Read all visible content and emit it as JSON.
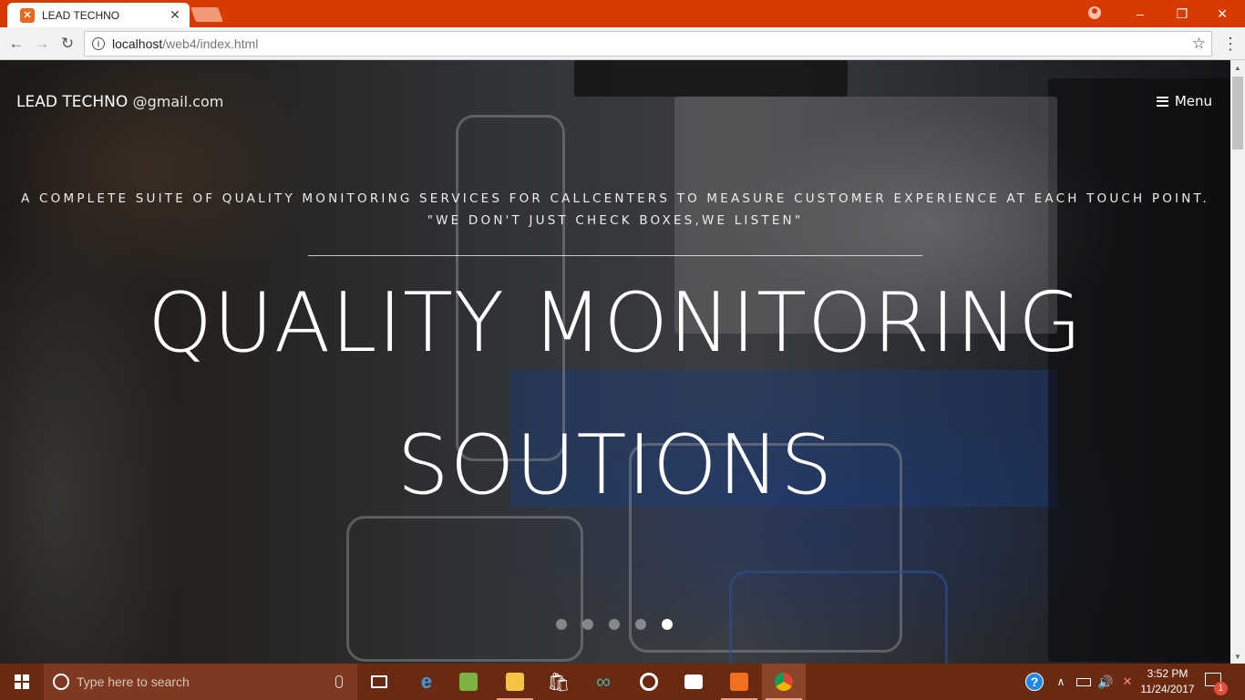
{
  "browser": {
    "tab_title": "LEAD TECHNO",
    "tab_favicon": "xampp-icon",
    "url_host": "localhost",
    "url_path": "/web4/index.html"
  },
  "site": {
    "brand_main": "LEAD TECHNO",
    "brand_sub": "@gmail.com",
    "menu_label": "Menu",
    "tagline_line1": "A COMPLETE SUITE OF QUALITY MONITORING SERVICES FOR CALLCENTERS TO MEASURE CUSTOMER EXPERIENCE AT EACH TOUCH POINT.",
    "tagline_line2": "\"WE DON'T JUST CHECK BOXES,WE LISTEN\"",
    "headline_line1": "QUALITY MONITORING",
    "headline_line2": "SOUTIONS",
    "carousel": {
      "slide_count": 5,
      "active_index": 4
    }
  },
  "taskbar": {
    "search_placeholder": "Type here to search",
    "time": "3:52 PM",
    "date": "11/24/2017",
    "notification_count": "1",
    "pinned": [
      "task-view-icon",
      "edge-icon",
      "notepad-icon",
      "file-explorer-icon",
      "store-icon",
      "arduino-icon",
      "groove-music-icon",
      "movies-icon",
      "xampp-icon",
      "chrome-icon"
    ]
  },
  "colors": {
    "titlebar": "#d83b01",
    "taskbar": "#6a2a12"
  }
}
